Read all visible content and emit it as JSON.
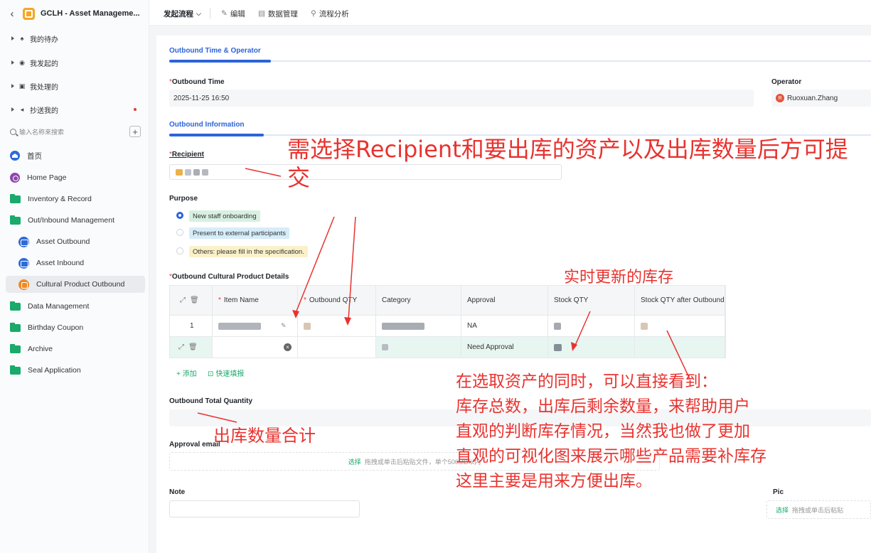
{
  "sidebar": {
    "app_title": "GCLH - Asset Manageme...",
    "tasks": [
      {
        "label": "我的待办",
        "icon": "bell-icon"
      },
      {
        "label": "我发起的",
        "icon": "play-circle-icon"
      },
      {
        "label": "我处理的",
        "icon": "inbox-icon"
      },
      {
        "label": "抄送我的",
        "icon": "send-icon"
      }
    ],
    "search_placeholder": "输入名称来搜索",
    "nav": [
      {
        "label": "首页",
        "icon": "home-icon"
      },
      {
        "label": "Home Page",
        "icon": "homepage-icon"
      },
      {
        "label": "Inventory & Record",
        "icon": "folder-icon"
      },
      {
        "label": "Out/Inbound Management",
        "icon": "folder-icon"
      },
      {
        "label": "Asset Outbound",
        "icon": "outbound-form-icon"
      },
      {
        "label": "Asset Inbound",
        "icon": "inbound-form-icon"
      },
      {
        "label": "Cultural Product Outbound",
        "icon": "cultural-form-icon"
      },
      {
        "label": "Data Management",
        "icon": "folder-icon"
      },
      {
        "label": "Birthday Coupon",
        "icon": "folder-icon"
      },
      {
        "label": "Archive",
        "icon": "folder-icon"
      },
      {
        "label": "Seal Application",
        "icon": "folder-icon"
      }
    ]
  },
  "toolbar": {
    "start_process": "发起流程",
    "edit": "编辑",
    "data_manage": "数据管理",
    "process_analysis": "流程分析"
  },
  "form": {
    "tab1": "Outbound Time & Operator",
    "outbound_time_label": "Outbound Time",
    "outbound_time_value": "2025-11-25 16:50",
    "operator_label": "Operator",
    "operator_initial": "R",
    "operator_value": "Ruoxuan.Zhang",
    "tab2": "Outbound Information",
    "recipient_label": "Recipient",
    "purpose_label": "Purpose",
    "purpose_options": [
      "New staff onboarding",
      "Present to external participants",
      "Others: please fill in the specification."
    ],
    "purpose_selected": "New staff onboarding",
    "details_label": "Outbound Cultural Product Details",
    "table_headers": [
      "Item Name",
      "Outbound QTY",
      "Category",
      "Approval",
      "Stock QTY",
      "Stock QTY after Outbound"
    ],
    "rows": [
      {
        "index": "1",
        "approval": "NA"
      },
      {
        "index": "",
        "approval": "Need Approval"
      }
    ],
    "add_label": "+ 添加",
    "quick_fill_label": "快速填报",
    "total_qty_label": "Outbound Total Quantity",
    "approval_email_label": "Approval email",
    "upload_select": "选择",
    "upload_hint": "拖拽或单击后粘贴文件，单个500MB以内",
    "note_label": "Note",
    "pic_label": "Pic",
    "pic_upload_hint": "拖拽或单击后粘贴"
  },
  "annotations": {
    "recipient_note": "需选择Recipient和要出库的资产以及出库数量后方可提交",
    "stock_note": "实时更新的库存",
    "total_note": "出库数量合计",
    "summary_lines": [
      "在选取资产的同时，可以直接看到：",
      "库存总数，出库后剩余数量，来帮助用户",
      "直观的判断库存情况，当然我也做了更加",
      "直观的可视化图来展示哪些产品需要补库存",
      "这里主要是用来方便出库。"
    ],
    "color": "#e8332f"
  },
  "colors": {
    "accent": "#2b64d9",
    "green": "#1aaa6b",
    "required": "#e53935"
  }
}
